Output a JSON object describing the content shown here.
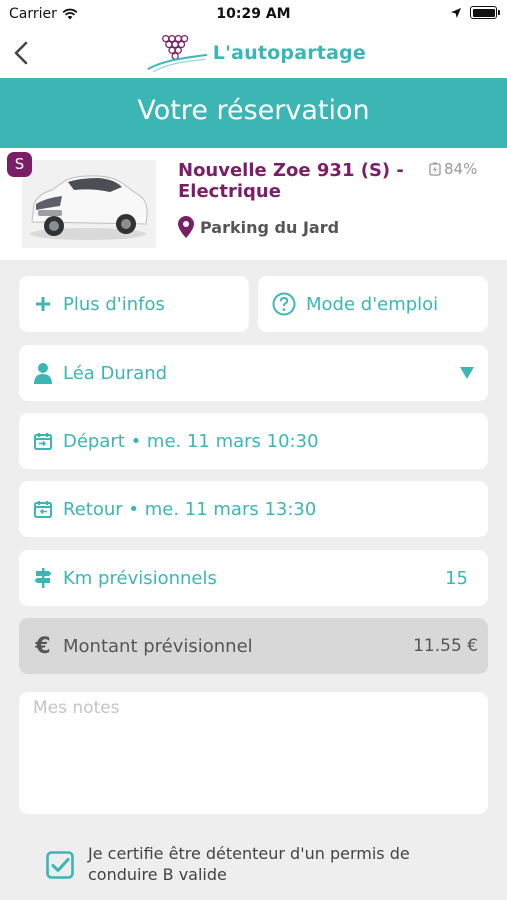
{
  "status_bar": {
    "carrier": "Carrier",
    "time": "10:29 AM"
  },
  "nav": {
    "logo_text": "L'autopartage"
  },
  "header": {
    "title": "Votre réservation"
  },
  "vehicle": {
    "badge": "S",
    "name": "Nouvelle Zoe 931 (S) - Electrique",
    "battery_percent": "84%",
    "location": "Parking du Jard"
  },
  "actions": {
    "more_info": "Plus d'infos",
    "user_guide": "Mode d'emploi"
  },
  "driver": {
    "name": "Léa Durand"
  },
  "departure": {
    "label": "Départ • me. 11 mars 10:30"
  },
  "return": {
    "label": "Retour • me. 11 mars 13:30"
  },
  "km": {
    "label": "Km prévisionnels",
    "value": "15"
  },
  "amount": {
    "label": "Montant prévisionnel",
    "value": "11.55 €"
  },
  "notes": {
    "placeholder": "Mes notes"
  },
  "certification": {
    "text": "Je certifie être détenteur d'un permis de conduire B valide",
    "checked": true
  },
  "colors": {
    "accent": "#3cb5b5",
    "brand": "#7a1f66",
    "background": "#eeeeee",
    "disabled_card": "#d8d8d8"
  },
  "icons": [
    "wifi-icon",
    "location-arrow-icon",
    "battery-icon",
    "back-chevron-icon",
    "grapes-logo-icon",
    "battery-small-icon",
    "map-pin-icon",
    "plus-icon",
    "question-circle-icon",
    "user-icon",
    "dropdown-triangle-icon",
    "calendar-depart-icon",
    "calendar-return-icon",
    "signpost-icon",
    "euro-icon",
    "checkbox-checked-icon"
  ]
}
